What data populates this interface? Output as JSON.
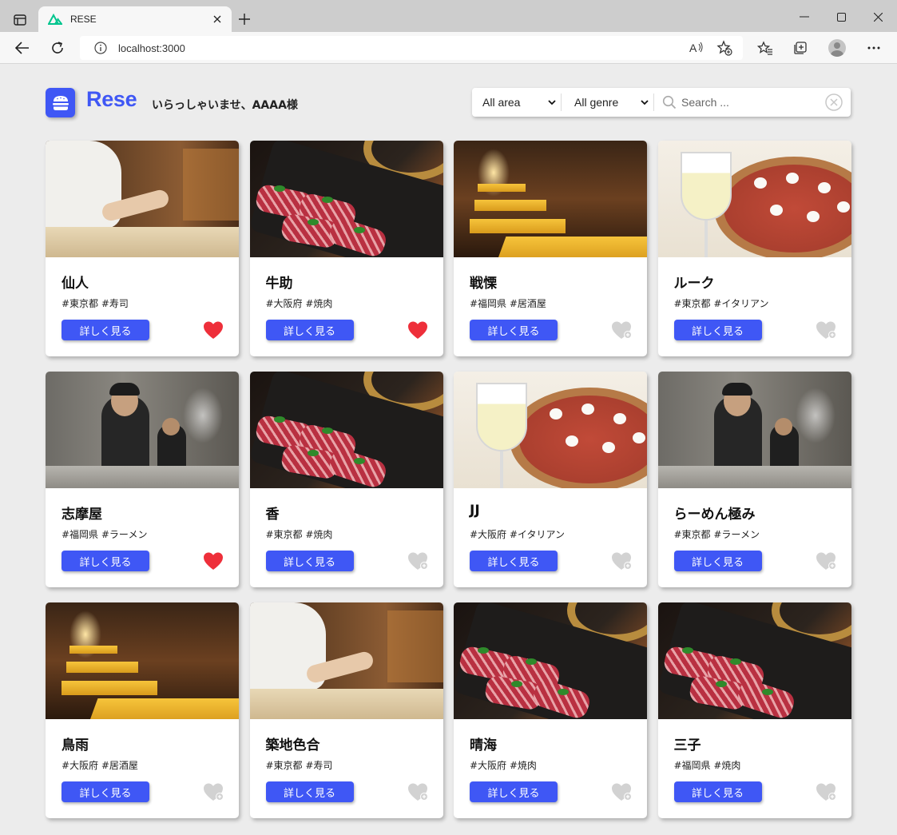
{
  "browser": {
    "tab_title": "RESE",
    "url": "localhost:3000"
  },
  "header": {
    "brand": "Rese",
    "greeting": "いらっしゃいませ、AAAA様"
  },
  "filters": {
    "area_selected": "All area",
    "genre_selected": "All genre",
    "search_placeholder": "Search ..."
  },
  "colors": {
    "brand": "#3f57f5",
    "favorite_on": "#ee2f3a",
    "favorite_off": "#d2d2d2"
  },
  "shops": [
    {
      "name": "仙人",
      "tags": "#東京都 #寿司",
      "button": "詳しく見る",
      "favorite": true,
      "photo": "sushi"
    },
    {
      "name": "牛助",
      "tags": "#大阪府 #焼肉",
      "button": "詳しく見る",
      "favorite": true,
      "photo": "wagyu"
    },
    {
      "name": "戦慄",
      "tags": "#福岡県 #居酒屋",
      "button": "詳しく見る",
      "favorite": false,
      "photo": "izakaya"
    },
    {
      "name": "ルーク",
      "tags": "#東京都 #イタリアン",
      "button": "詳しく見る",
      "favorite": false,
      "photo": "pizza"
    },
    {
      "name": "志摩屋",
      "tags": "#福岡県 #ラーメン",
      "button": "詳しく見る",
      "favorite": true,
      "photo": "ramen"
    },
    {
      "name": "香",
      "tags": "#東京都 #焼肉",
      "button": "詳しく見る",
      "favorite": false,
      "photo": "wagyu"
    },
    {
      "name": "JJ",
      "tags": "#大阪府 #イタリアン",
      "button": "詳しく見る",
      "favorite": false,
      "photo": "pizza"
    },
    {
      "name": "らーめん極み",
      "tags": "#東京都 #ラーメン",
      "button": "詳しく見る",
      "favorite": false,
      "photo": "ramen"
    },
    {
      "name": "鳥雨",
      "tags": "#大阪府 #居酒屋",
      "button": "詳しく見る",
      "favorite": false,
      "photo": "izakaya"
    },
    {
      "name": "築地色合",
      "tags": "#東京都 #寿司",
      "button": "詳しく見る",
      "favorite": false,
      "photo": "sushi"
    },
    {
      "name": "晴海",
      "tags": "#大阪府 #焼肉",
      "button": "詳しく見る",
      "favorite": false,
      "photo": "wagyu"
    },
    {
      "name": "三子",
      "tags": "#福岡県 #焼肉",
      "button": "詳しく見る",
      "favorite": false,
      "photo": "wagyu"
    }
  ]
}
